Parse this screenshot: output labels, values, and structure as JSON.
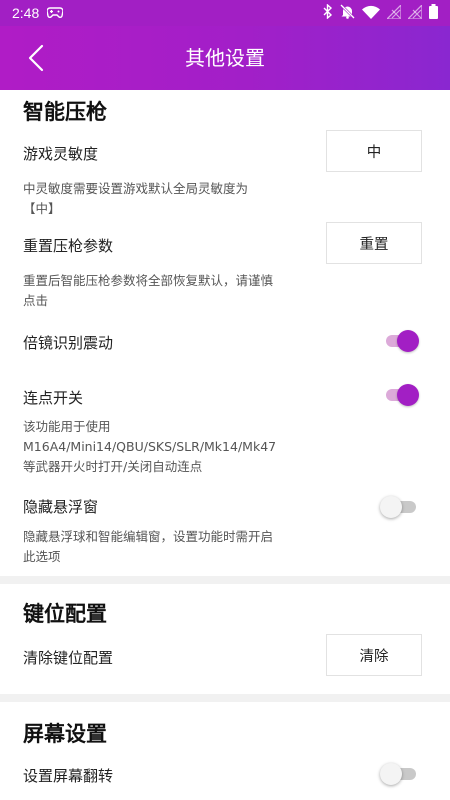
{
  "status_bar": {
    "time": "2:48",
    "icons": [
      "gamepad-icon",
      "bluetooth-icon",
      "mute-icon",
      "wifi-icon",
      "signal-off-icon",
      "signal-off-icon",
      "battery-icon"
    ]
  },
  "header": {
    "back_icon": "chevron-left-icon",
    "title": "其他设置"
  },
  "sections": {
    "smart_recoil": {
      "title": "智能压枪",
      "sensitivity": {
        "label": "游戏灵敏度",
        "value": "中",
        "desc": "中灵敏度需要设置游戏默认全局灵敏度为【中】"
      },
      "reset": {
        "label": "重置压枪参数",
        "button": "重置",
        "desc": "重置后智能压枪参数将全部恢复默认，请谨慎点击"
      },
      "scope_vibration": {
        "label": "倍镜识别震动",
        "on": true
      },
      "burst_switch": {
        "label": "连点开关",
        "on": true,
        "desc": "该功能用于使用M16A4/Mini14/QBU/SKS/SLR/Mk14/Mk47等武器开火时打开/关闭自动连点"
      },
      "hide_float": {
        "label": "隐藏悬浮窗",
        "on": false,
        "desc": "隐藏悬浮球和智能编辑窗，设置功能时需开启此选项"
      }
    },
    "key_config": {
      "title": "键位配置",
      "clear": {
        "label": "清除键位配置",
        "button": "清除"
      }
    },
    "screen": {
      "title": "屏幕设置",
      "flip": {
        "label": "设置屏幕翻转",
        "on": false
      }
    }
  },
  "colors": {
    "accent": "#a21fc4",
    "header_start": "#b01cc6",
    "header_end": "#8a27d0"
  }
}
